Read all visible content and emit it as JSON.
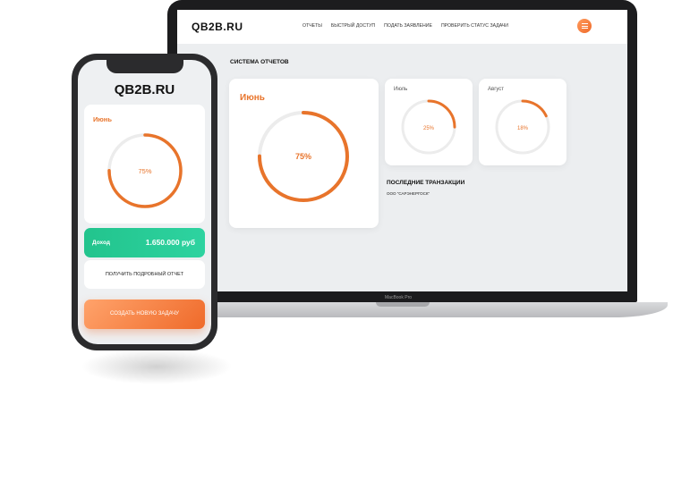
{
  "laptop": {
    "logo": "QB2B.RU",
    "nav": [
      "ОТЧЕТЫ",
      "БЫСТРЫЙ ДОСТУП",
      "ПОДАТЬ ЗАЯВЛЕНИЕ",
      "ПРОВЕРИТЬ СТАТУС ЗАДАЧИ"
    ],
    "section_title": "СИСТЕМА ОТЧЕТОВ",
    "reports": [
      {
        "month": "Июнь",
        "percent_label": "75%",
        "progress": 0.75
      },
      {
        "month": "Июль",
        "percent_label": "25%",
        "progress": 0.25
      },
      {
        "month": "Август",
        "percent_label": "18%",
        "progress": 0.18
      }
    ],
    "transactions_title": "ПОСЛЕДНИЕ ТРАНЗАКЦИИ",
    "transactions": [
      "ООО \"САРЭНЕРГОСК\""
    ],
    "brand": "MacBook Pro"
  },
  "phone": {
    "logo": "QB2B.RU",
    "report": {
      "month": "Июнь",
      "percent_label": "75%",
      "progress": 0.75
    },
    "income_label": "Доход",
    "income_value": "1.650.000 руб",
    "report_button": "ПОЛУЧИТЬ ПОДРОБНЫЙ ОТЧЕТ",
    "task_button": "СОЗДАТЬ НОВУЮ ЗАДАЧУ"
  },
  "colors": {
    "accent": "#e8742b",
    "income": "#22c48d",
    "track": "#ececec"
  }
}
